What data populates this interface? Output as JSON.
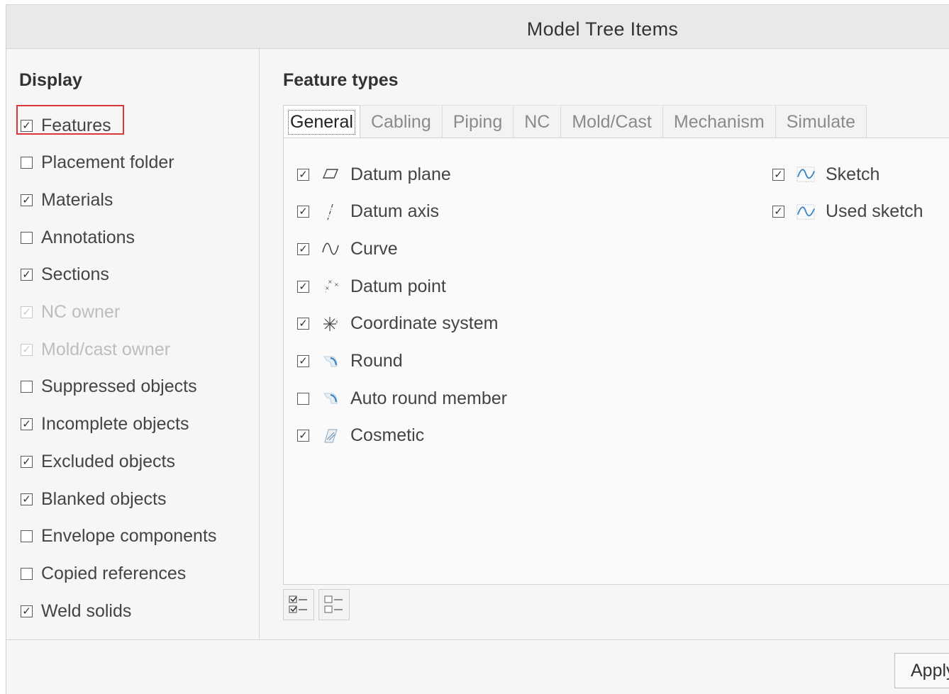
{
  "window": {
    "title": "Model Tree Items"
  },
  "display": {
    "heading": "Display",
    "items": [
      {
        "label": "Features",
        "checked": true,
        "enabled": true,
        "highlighted": true
      },
      {
        "label": "Placement folder",
        "checked": false,
        "enabled": true
      },
      {
        "label": "Materials",
        "checked": true,
        "enabled": true
      },
      {
        "label": "Annotations",
        "checked": false,
        "enabled": true
      },
      {
        "label": "Sections",
        "checked": true,
        "enabled": true
      },
      {
        "label": "NC owner",
        "checked": true,
        "enabled": false
      },
      {
        "label": "Mold/cast owner",
        "checked": true,
        "enabled": false
      },
      {
        "label": "Suppressed objects",
        "checked": false,
        "enabled": true
      },
      {
        "label": "Incomplete objects",
        "checked": true,
        "enabled": true
      },
      {
        "label": "Excluded objects",
        "checked": true,
        "enabled": true
      },
      {
        "label": "Blanked objects",
        "checked": true,
        "enabled": true
      },
      {
        "label": "Envelope components",
        "checked": false,
        "enabled": true
      },
      {
        "label": "Copied references",
        "checked": false,
        "enabled": true
      },
      {
        "label": "Weld solids",
        "checked": true,
        "enabled": true
      }
    ]
  },
  "feature_types": {
    "heading": "Feature types",
    "tabs": [
      "General",
      "Cabling",
      "Piping",
      "NC",
      "Mold/Cast",
      "Mechanism",
      "Simulate"
    ],
    "active_tab": "General",
    "items_left": [
      {
        "label": "Datum plane",
        "checked": true,
        "icon": "datum-plane-icon"
      },
      {
        "label": "Datum axis",
        "checked": true,
        "icon": "datum-axis-icon"
      },
      {
        "label": "Curve",
        "checked": true,
        "icon": "curve-icon"
      },
      {
        "label": "Datum point",
        "checked": true,
        "icon": "datum-point-icon"
      },
      {
        "label": "Coordinate system",
        "checked": true,
        "icon": "coordinate-system-icon"
      },
      {
        "label": "Round",
        "checked": true,
        "icon": "round-icon"
      },
      {
        "label": "Auto round member",
        "checked": false,
        "icon": "auto-round-icon"
      },
      {
        "label": "Cosmetic",
        "checked": true,
        "icon": "cosmetic-icon"
      }
    ],
    "items_right": [
      {
        "label": "Sketch",
        "checked": true,
        "icon": "sketch-icon"
      },
      {
        "label": "Used sketch",
        "checked": true,
        "icon": "used-sketch-icon"
      }
    ],
    "buttons": {
      "select_all": "select-all-icon",
      "clear_all": "clear-all-icon"
    }
  },
  "footer": {
    "apply_label": "Apply"
  },
  "colors": {
    "highlight": "#d9373a",
    "icon_blue": "#3b86c6"
  }
}
